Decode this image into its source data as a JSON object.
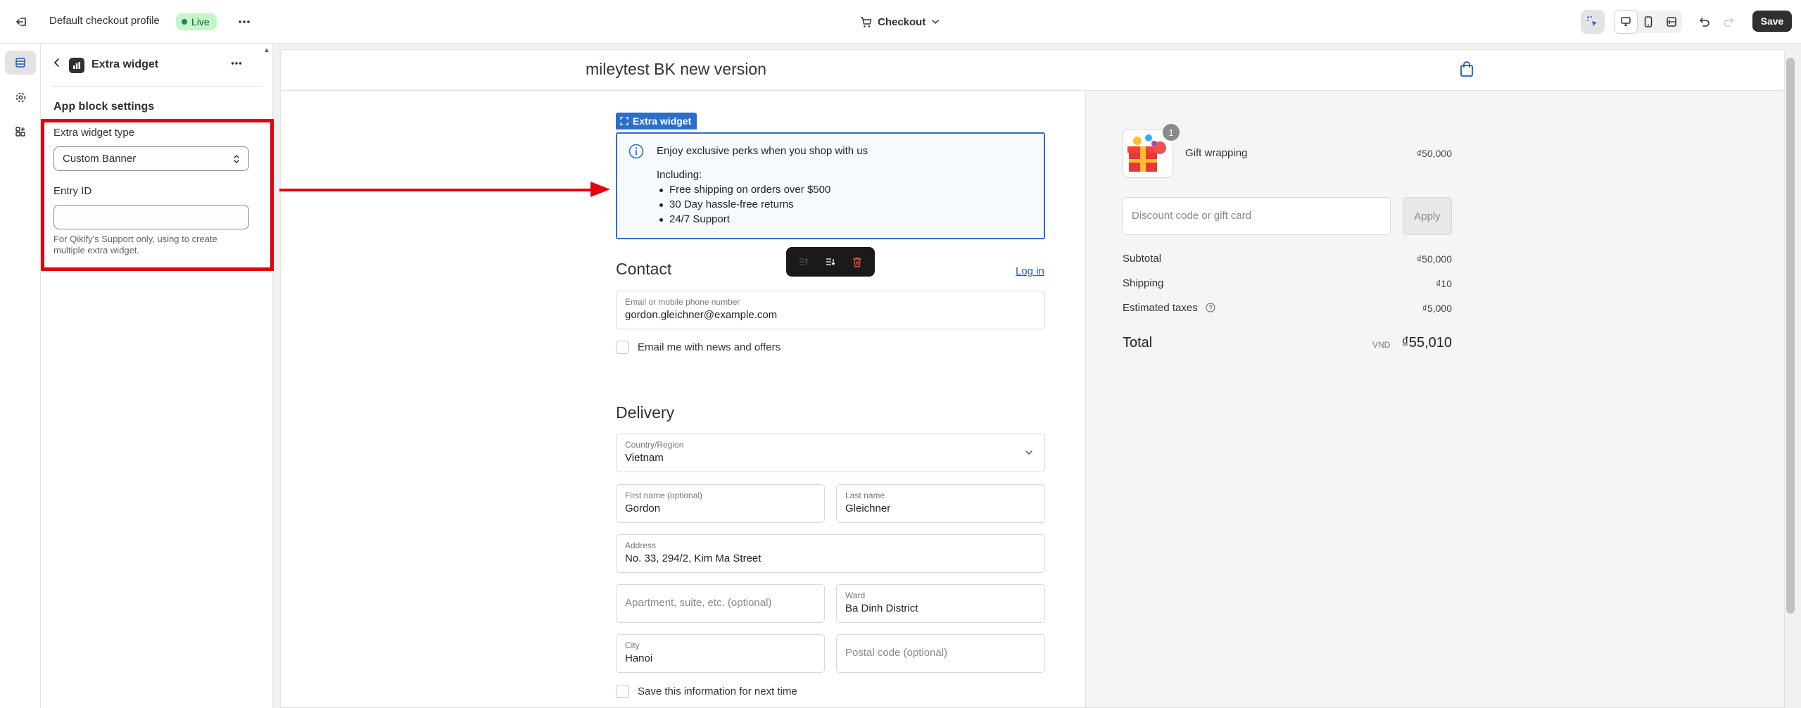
{
  "topbar": {
    "profile_name": "Default checkout profile",
    "status_badge": "Live",
    "page_selector": "Checkout",
    "save_label": "Save",
    "icons": [
      "exit-icon",
      "more-icon",
      "cart-icon",
      "chevron-down-icon",
      "inspector-icon",
      "desktop-icon",
      "mobile-icon",
      "fullwidth-icon",
      "undo-icon",
      "redo-icon"
    ]
  },
  "rail": {
    "icons": [
      "sections-icon",
      "settings-icon",
      "apps-icon"
    ]
  },
  "panel": {
    "title": "Extra widget",
    "section_heading": "App block settings",
    "widget_type_label": "Extra widget type",
    "widget_type_value": "Custom Banner",
    "entry_id_label": "Entry ID",
    "entry_id_value": "",
    "help_text": "For Qikify's Support only, using to create multiple extra widget."
  },
  "preview": {
    "store_name": "mileytest BK new version",
    "widget_tag": "Extra widget",
    "banner": {
      "headline": "Enjoy exclusive perks when you shop with us",
      "including": "Including:",
      "items": [
        "Free shipping on orders over $500",
        "30 Day hassle-free returns",
        "24/7 Support"
      ]
    },
    "contact": {
      "heading": "Contact",
      "login_link": "Log in",
      "email_label": "Email or mobile phone number",
      "email_value": "gordon.gleichner@example.com",
      "news_label": "Email me with news and offers"
    },
    "delivery": {
      "heading": "Delivery",
      "country_label": "Country/Region",
      "country_value": "Vietnam",
      "first_name_label": "First name (optional)",
      "first_name_value": "Gordon",
      "last_name_label": "Last name",
      "last_name_value": "Gleichner",
      "address_label": "Address",
      "address_value": "No. 33, 294/2, Kim Ma Street",
      "apartment_placeholder": "Apartment, suite, etc. (optional)",
      "ward_label": "Ward",
      "ward_value": "Ba Dinh District",
      "city_label": "City",
      "city_value": "Hanoi",
      "postal_placeholder": "Postal code (optional)",
      "save_info_label": "Save this information for next time"
    },
    "summary": {
      "item_name": "Gift wrapping",
      "item_qty": "1",
      "item_price": "₫50,000",
      "discount_placeholder": "Discount code or gift card",
      "apply_label": "Apply",
      "subtotal_label": "Subtotal",
      "subtotal_value": "₫50,000",
      "shipping_label": "Shipping",
      "shipping_value": "₫10",
      "taxes_label": "Estimated taxes",
      "taxes_value": "₫5,000",
      "total_label": "Total",
      "currency": "VND",
      "total_value": "₫55,010"
    }
  },
  "colors": {
    "accent": "#2c6ecb",
    "annotation": "#e3000f",
    "live_badge_bg": "#c3f7c9",
    "dark_button": "#303030"
  }
}
